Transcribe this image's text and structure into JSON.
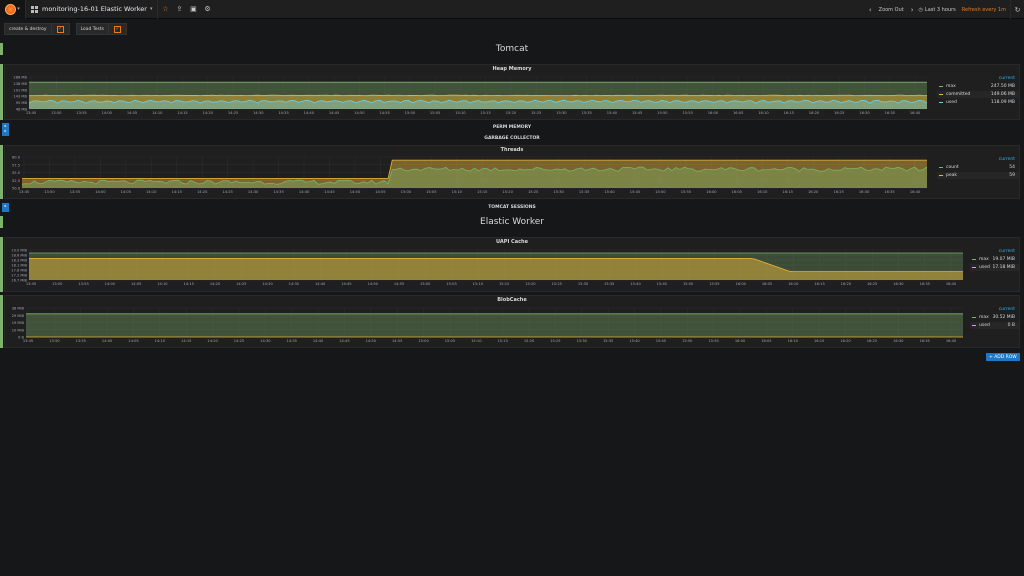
{
  "navbar": {
    "dashboard_title": "monitoring-16-01 Elastic Worker",
    "zoom_out": "Zoom Out",
    "time_range": "Last 3 hours",
    "refresh": "Refresh every 1m",
    "icons": [
      "grafana-logo-icon",
      "star-icon",
      "share-icon",
      "save-icon",
      "gear-icon",
      "clock-icon",
      "refresh-icon"
    ]
  },
  "templating": {
    "vars": [
      {
        "label": "create & destroy",
        "checked": true
      },
      {
        "label": "Load Tests",
        "checked": true
      }
    ]
  },
  "rows": {
    "tomcat": "Tomcat",
    "perm_memory": "PERM MEMORY",
    "garbage_collector": "GARBAGE COLLECTOR",
    "tomcat_sessions": "TOMCAT SESSIONS",
    "elastic_worker": "Elastic Worker"
  },
  "add_row": "+ ADD ROW",
  "chart_data": [
    {
      "type": "area",
      "title": "Heap Memory",
      "y_ticks": [
        "286 MB",
        "238 MB",
        "191 MB",
        "143 MB",
        "95 MB",
        "48 MB"
      ],
      "x_ticks": [
        "13:45",
        "13:50",
        "13:55",
        "14:00",
        "14:05",
        "14:10",
        "14:15",
        "14:20",
        "14:25",
        "14:30",
        "14:35",
        "14:40",
        "14:45",
        "14:50",
        "14:55",
        "15:00",
        "15:05",
        "15:10",
        "15:15",
        "15:20",
        "15:25",
        "15:30",
        "15:35",
        "15:40",
        "15:45",
        "15:50",
        "15:55",
        "16:00",
        "16:05",
        "16:10",
        "16:15",
        "16:20",
        "16:25",
        "16:30",
        "16:35",
        "16:40"
      ],
      "ylim": [
        48,
        286
      ],
      "legend_header": "current",
      "series": [
        {
          "name": "max",
          "current": "247.50 MB",
          "color": "#7eb26d",
          "level_mb": 247.5
        },
        {
          "name": "committed",
          "current": "149.06 MB",
          "color": "#eab839",
          "level_mb": 149
        },
        {
          "name": "used",
          "current": "118.09 MB",
          "color": "#6ed0e0",
          "level_mb": 100
        }
      ]
    },
    {
      "type": "area",
      "title": "Threads",
      "y_ticks": [
        "60.0",
        "57.5",
        "55.0",
        "52.5",
        "50.0"
      ],
      "x_ticks": [
        "13:45",
        "13:50",
        "13:55",
        "14:00",
        "14:05",
        "14:10",
        "14:15",
        "14:20",
        "14:25",
        "14:30",
        "14:35",
        "14:40",
        "14:45",
        "14:50",
        "14:55",
        "15:00",
        "15:05",
        "15:10",
        "15:15",
        "15:20",
        "15:25",
        "15:30",
        "15:35",
        "15:40",
        "15:45",
        "15:50",
        "15:55",
        "16:00",
        "16:05",
        "16:10",
        "16:15",
        "16:20",
        "16:25",
        "16:30",
        "16:35",
        "16:40"
      ],
      "ylim": [
        50,
        60
      ],
      "legend_header": "current",
      "series": [
        {
          "name": "count",
          "current": "54",
          "color": "#7eb26d"
        },
        {
          "name": "peak",
          "current": "59",
          "color": "#eab839"
        }
      ],
      "step": {
        "before": 52.8,
        "after": 59,
        "at_fraction": 0.405
      }
    },
    {
      "type": "area",
      "title": "UAPI Cache",
      "y_ticks": [
        "19.0 MiB",
        "18.6 MiB",
        "18.3 MiB",
        "18.1 MiB",
        "17.8 MiB",
        "17.2 MiB",
        "16.7 MiB"
      ],
      "x_ticks": [
        "13:45",
        "13:50",
        "13:55",
        "14:00",
        "14:05",
        "14:10",
        "14:15",
        "14:20",
        "14:25",
        "14:30",
        "14:35",
        "14:40",
        "14:45",
        "14:50",
        "14:55",
        "15:00",
        "15:05",
        "15:10",
        "15:15",
        "15:20",
        "15:25",
        "15:30",
        "15:35",
        "15:40",
        "15:45",
        "15:50",
        "15:55",
        "16:00",
        "16:05",
        "16:10",
        "16:15",
        "16:20",
        "16:25",
        "16:30",
        "16:35",
        "16:40"
      ],
      "legend_header": "current",
      "series": [
        {
          "name": "max",
          "current": "19.07 MiB",
          "color": "#7eb26d"
        },
        {
          "name": "used",
          "current": "17.18 MiB",
          "color": "#eab839"
        }
      ],
      "drop": {
        "before_fraction": 0.72,
        "after_fraction": 0.28,
        "start": 0.775,
        "end": 0.815
      }
    },
    {
      "type": "area",
      "title": "BlobCache",
      "y_ticks": [
        "38 MiB",
        "29 MiB",
        "19 MiB",
        "10 MiB",
        "0 B"
      ],
      "x_ticks": [
        "13:45",
        "13:50",
        "13:55",
        "14:00",
        "14:05",
        "14:10",
        "14:15",
        "14:20",
        "14:25",
        "14:30",
        "14:35",
        "14:40",
        "14:45",
        "14:50",
        "14:55",
        "15:00",
        "15:05",
        "15:10",
        "15:15",
        "15:20",
        "15:25",
        "15:30",
        "15:35",
        "15:40",
        "15:45",
        "15:50",
        "15:55",
        "16:00",
        "16:05",
        "16:10",
        "16:15",
        "16:20",
        "16:25",
        "16:30",
        "16:35",
        "16:40"
      ],
      "legend_header": "current",
      "series": [
        {
          "name": "max",
          "current": "30.52 MiB",
          "color": "#7eb26d"
        },
        {
          "name": "used",
          "current": "0 B",
          "color": "#eab839"
        }
      ]
    }
  ]
}
